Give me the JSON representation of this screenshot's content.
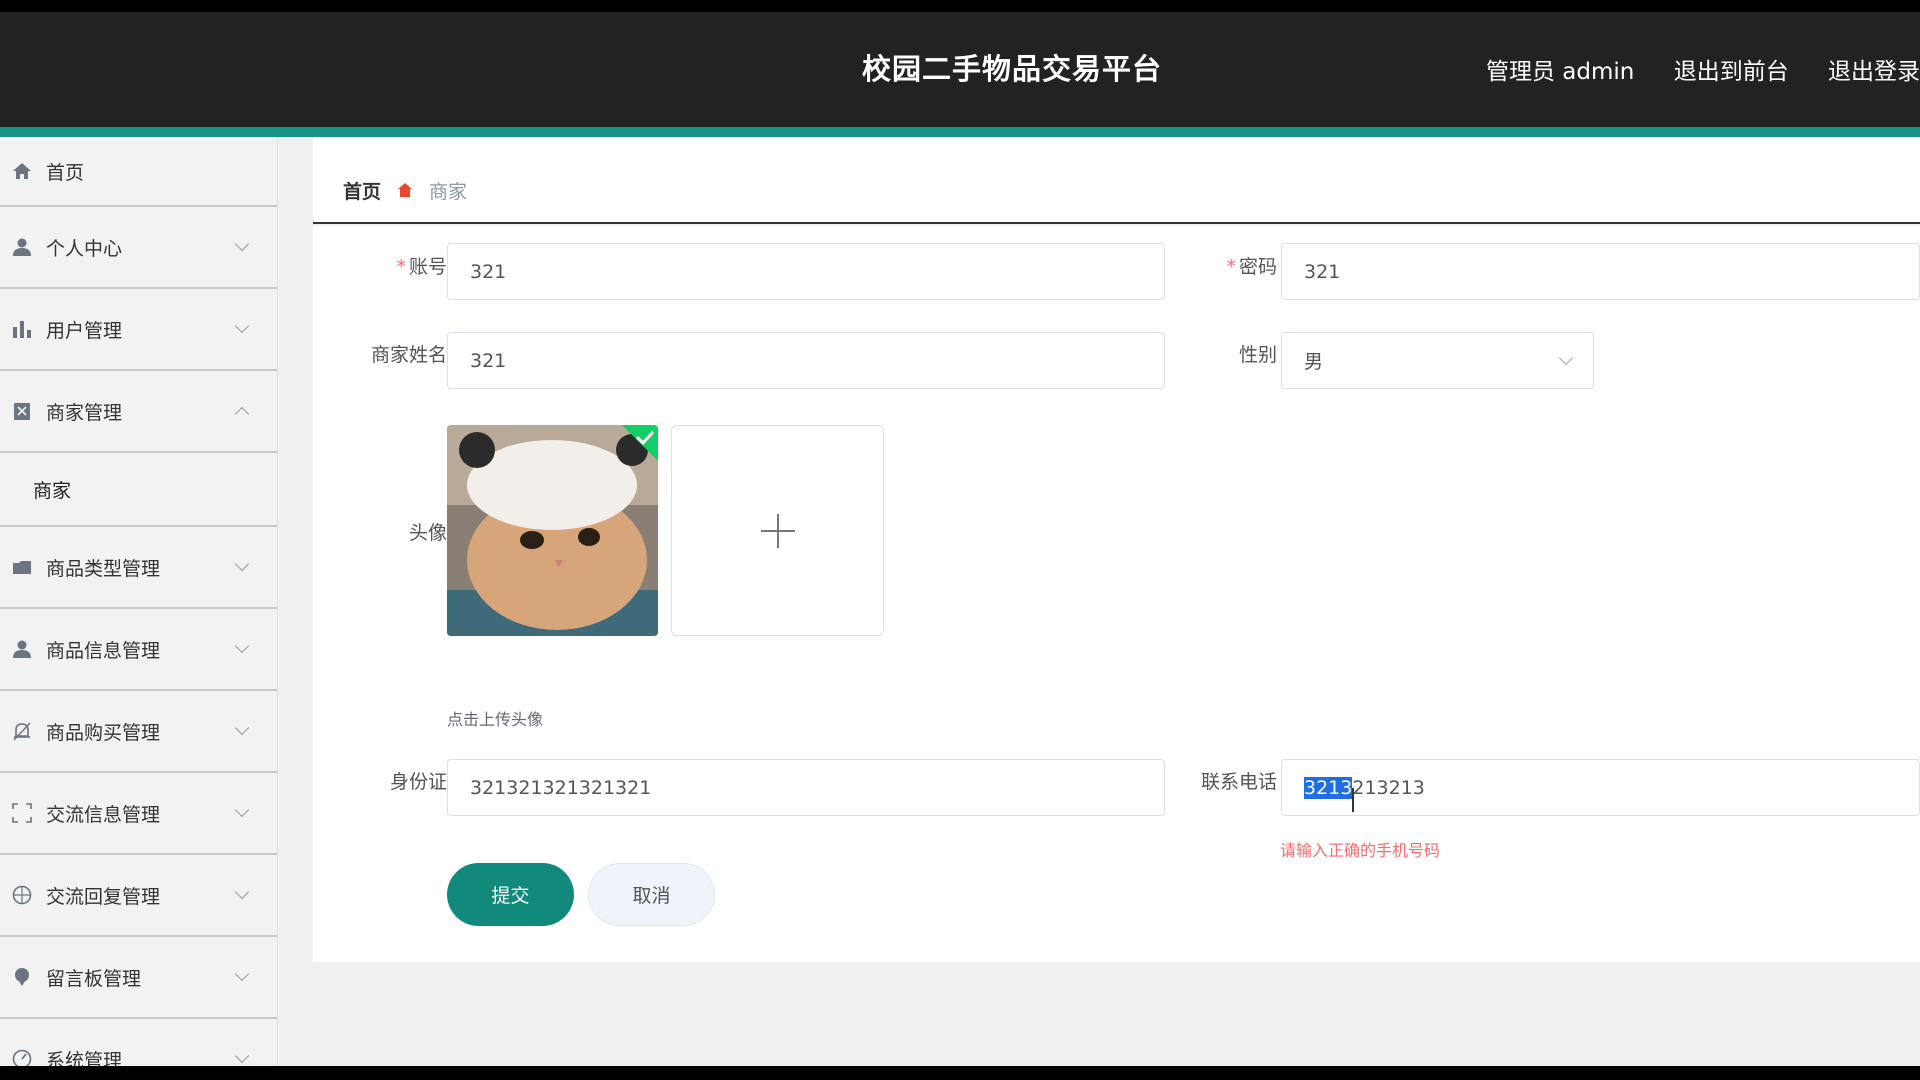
{
  "header": {
    "title": "校园二手物品交易平台",
    "admin": "管理员 admin",
    "front": "退出到前台",
    "logout": "退出登录"
  },
  "sidebar": {
    "items": [
      {
        "label": "首页",
        "icon": "home-icon"
      },
      {
        "label": "个人中心",
        "icon": "user-icon"
      },
      {
        "label": "用户管理",
        "icon": "bar-chart-icon"
      },
      {
        "label": "商家管理",
        "icon": "clipboard-icon",
        "expanded": true
      },
      {
        "label": "商品类型管理",
        "icon": "folder-icon"
      },
      {
        "label": "商品信息管理",
        "icon": "person-icon"
      },
      {
        "label": "商品购买管理",
        "icon": "bell-icon"
      },
      {
        "label": "交流信息管理",
        "icon": "frame-icon"
      },
      {
        "label": "交流回复管理",
        "icon": "compass-icon"
      },
      {
        "label": "留言板管理",
        "icon": "pin-icon"
      },
      {
        "label": "系统管理",
        "icon": "gauge-icon"
      }
    ],
    "sub_item": "商家"
  },
  "breadcrumb": {
    "home": "首页",
    "current": "商家"
  },
  "form": {
    "account_label": "账号",
    "account_value": "321",
    "password_label": "密码",
    "password_value": "321",
    "name_label": "商家姓名",
    "name_value": "321",
    "gender_label": "性别",
    "gender_value": "男",
    "avatar_label": "头像",
    "avatar_hint": "点击上传头像",
    "idcard_label": "身份证",
    "idcard_value": "321321321321321",
    "phone_label": "联系电话",
    "phone_selected": "3213",
    "phone_rest": "213213",
    "phone_error": "请输入正确的手机号码",
    "submit": "提交",
    "cancel": "取消"
  },
  "colors": {
    "accent": "#149586",
    "submit": "#11897b",
    "error": "#f56c6c"
  }
}
